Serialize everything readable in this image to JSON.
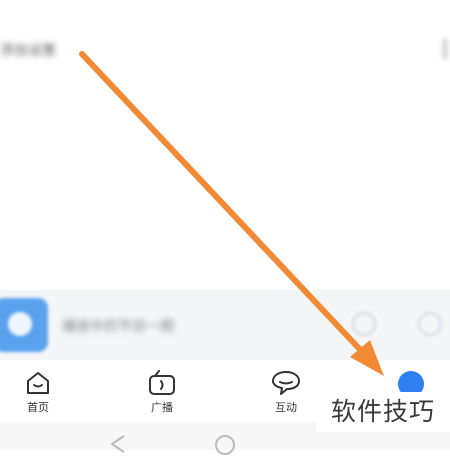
{
  "header": {
    "title": "添加设置"
  },
  "player": {
    "title": "播放中的节目一期"
  },
  "tabbar": {
    "tabs": [
      {
        "label": "首页",
        "icon": "home-icon"
      },
      {
        "label": "广播",
        "icon": "radio-icon"
      },
      {
        "label": "互动",
        "icon": "chat-bubble-icon"
      }
    ],
    "profile_icon": "profile-dot-icon"
  },
  "navigation": {
    "back_icon": "nav-back-icon",
    "home_icon": "nav-home-icon"
  },
  "annotation": {
    "arrow_color": "#f28a35"
  },
  "watermark": {
    "text": "软件技巧"
  },
  "colors": {
    "accent": "#2f7ff0",
    "player_thumb": "#5aa2ee",
    "arrow": "#f28a35"
  }
}
